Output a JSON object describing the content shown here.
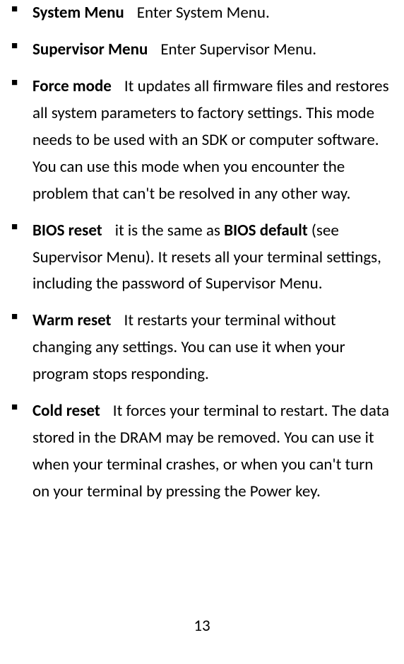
{
  "items": [
    {
      "term": "System Menu",
      "description": "Enter System Menu."
    },
    {
      "term": "Supervisor Menu",
      "description": "Enter Supervisor Menu."
    },
    {
      "term": "Force mode",
      "description": "It updates all firmware files and restores all system parameters to factory settings. This mode needs to be used with an SDK or computer software. You can use this mode when you encounter the problem that can't be resolved in any other way."
    },
    {
      "term": "BIOS reset",
      "description_pre": "it is the same as ",
      "description_bold": "BIOS default",
      "description_post": " (see Supervisor Menu). It resets all your terminal settings, including the password of Supervisor Menu."
    },
    {
      "term": "Warm reset",
      "description": "It restarts your terminal without changing any settings. You can use it when your program stops responding."
    },
    {
      "term": "Cold reset",
      "description": "It forces your terminal to restart. The data stored in the DRAM may be removed. You can use it when your terminal crashes, or when you can't turn on your terminal by pressing the Power key."
    }
  ],
  "page_number": "13"
}
